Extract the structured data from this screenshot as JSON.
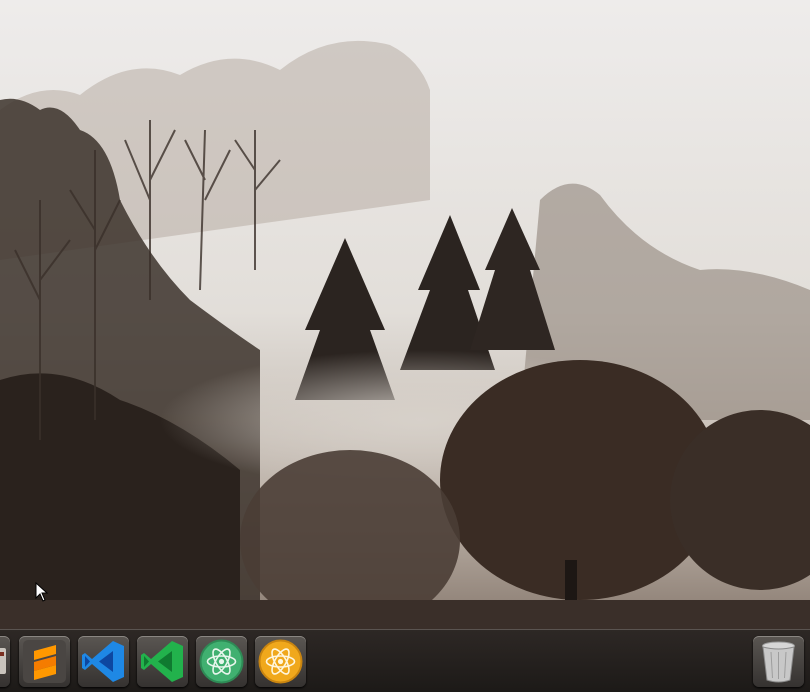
{
  "desktop": {
    "wallpaper": "foggy-forest-landscape",
    "colors": {
      "fog": "#e9e7e3",
      "trees": "#2c2420",
      "dock": "#1e1b19"
    }
  },
  "dock": {
    "items": [
      {
        "icon": "app-icon-partial",
        "tooltip": ""
      },
      {
        "icon": "sublime-text-icon",
        "tooltip": ""
      },
      {
        "icon": "visual-studio-code-icon",
        "tooltip": ""
      },
      {
        "icon": "visual-studio-icon",
        "tooltip": ""
      },
      {
        "icon": "atom-icon",
        "tooltip": ""
      },
      {
        "icon": "atom-beta-icon",
        "tooltip": ""
      }
    ],
    "trash": {
      "icon": "trash-icon"
    }
  }
}
